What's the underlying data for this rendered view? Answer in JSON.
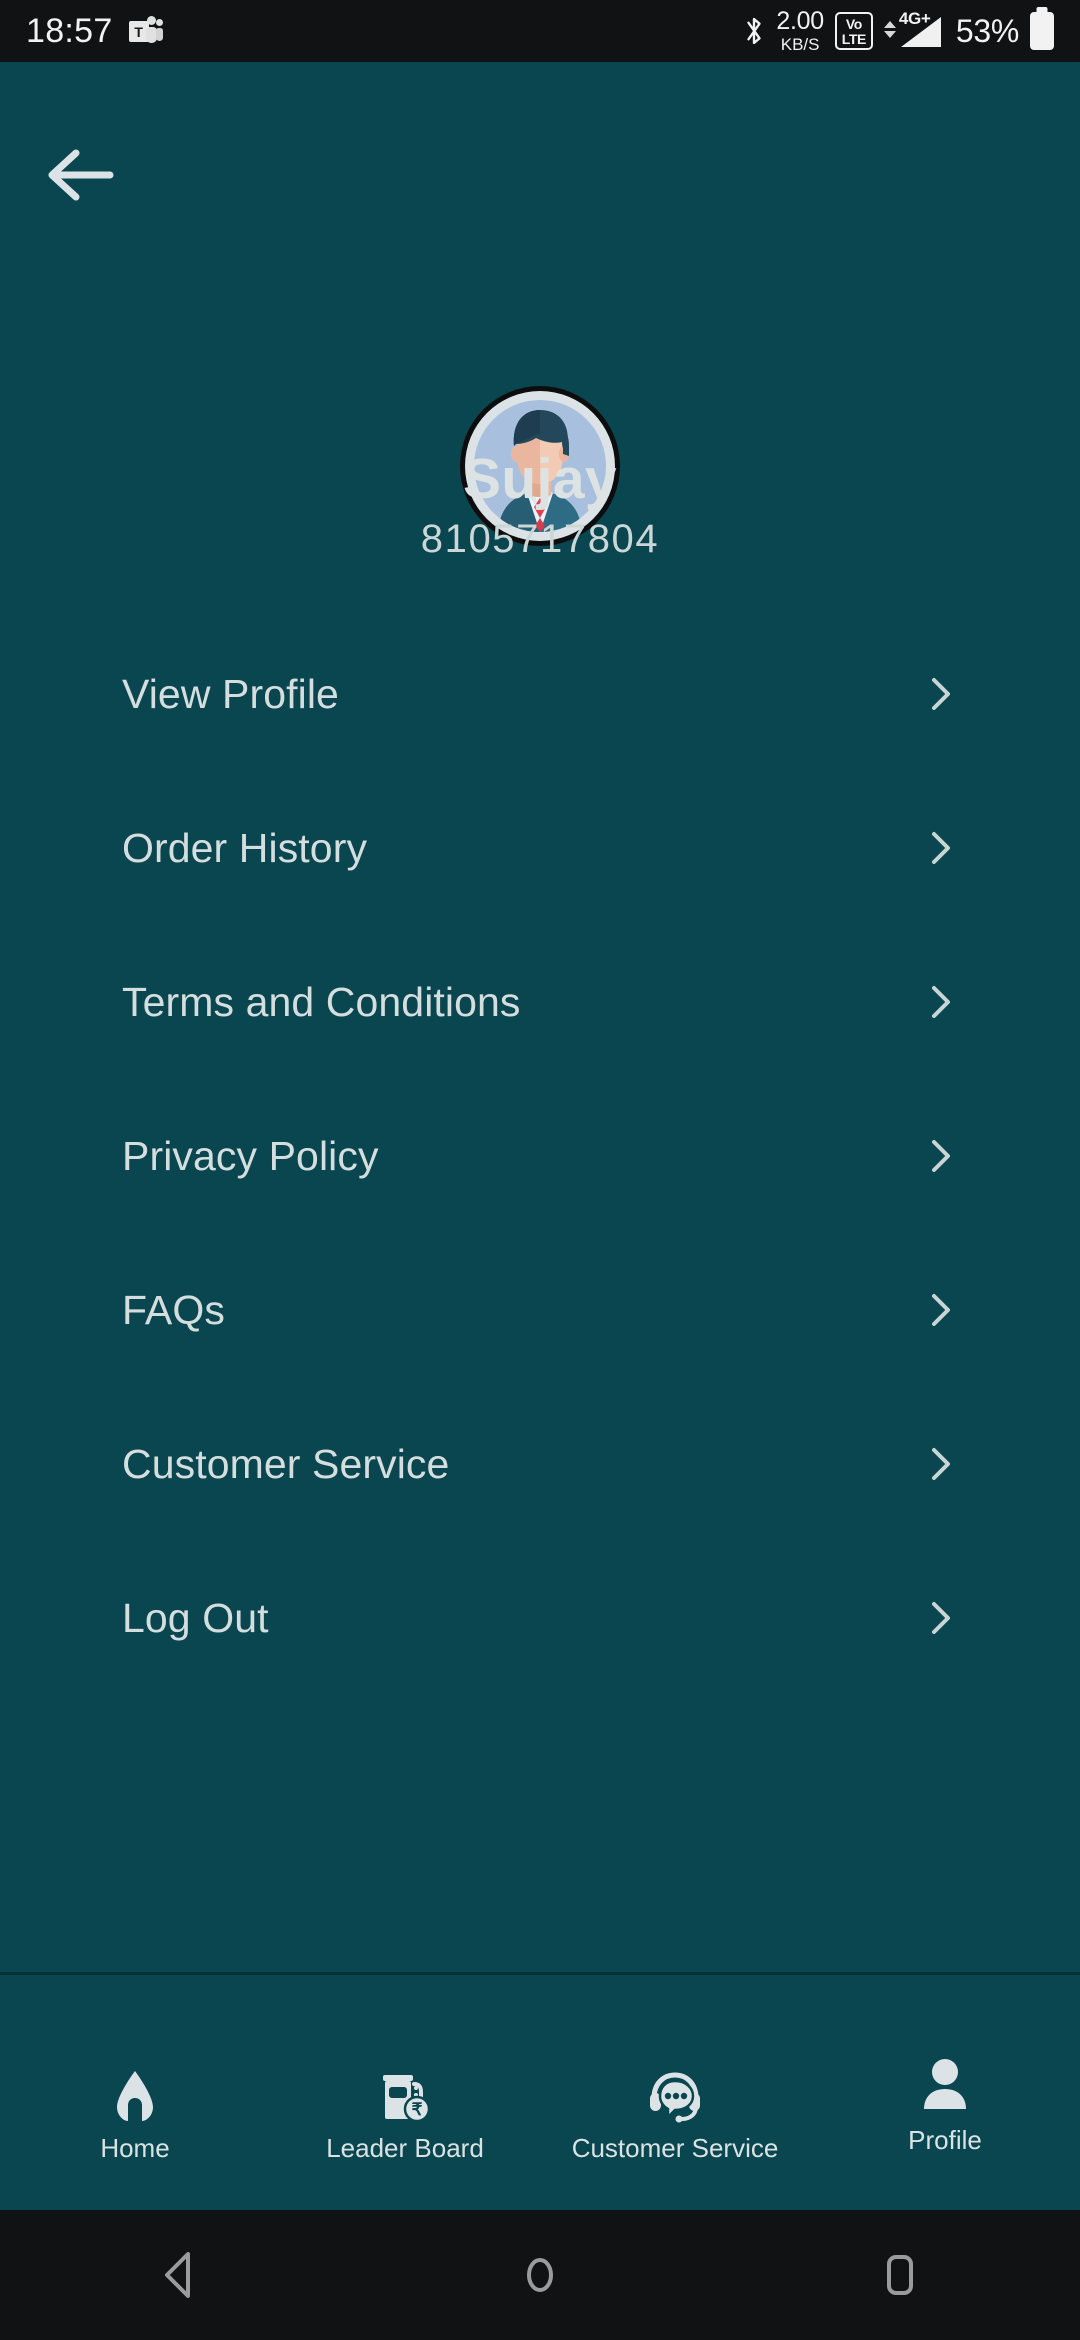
{
  "status_bar": {
    "clock": "18:57",
    "app_icon": "microsoft-teams-icon",
    "bluetooth_icon": "bluetooth-icon",
    "net_speed_value": "2.00",
    "net_speed_unit": "KB/S",
    "volte_top": "Vo",
    "volte_bottom": "LTE",
    "network_generation": "4G+",
    "signal_icon": "signal-bars-icon",
    "battery_percent": "53%",
    "battery_icon": "battery-icon",
    "background_color": "#111213",
    "text_color": "#F2F2F2"
  },
  "header": {
    "back_icon": "back-arrow-icon"
  },
  "profile": {
    "avatar_icon": "user-avatar-illustration",
    "name": "Sujay",
    "phone": "8105717804"
  },
  "menu": {
    "chevron_icon": "chevron-right-icon",
    "items": [
      {
        "label": "View Profile",
        "name": "view-profile"
      },
      {
        "label": "Order History",
        "name": "order-history"
      },
      {
        "label": "Terms and Conditions",
        "name": "terms-and-conditions"
      },
      {
        "label": "Privacy Policy",
        "name": "privacy-policy"
      },
      {
        "label": "FAQs",
        "name": "faqs"
      },
      {
        "label": "Customer Service",
        "name": "customer-service"
      },
      {
        "label": "Log Out",
        "name": "log-out"
      }
    ]
  },
  "bottom_nav": {
    "items": [
      {
        "label": "Home",
        "icon": "home-icon",
        "active": false
      },
      {
        "label": "Leader Board",
        "icon": "fuel-pump-rupee-icon",
        "active": false
      },
      {
        "label": "Customer Service",
        "icon": "headset-chat-icon",
        "active": false
      },
      {
        "label": "Profile",
        "icon": "person-icon",
        "active": true
      }
    ]
  },
  "android_nav": {
    "back_icon": "system-back-icon",
    "home_icon": "system-home-icon",
    "recents_icon": "system-recents-icon"
  },
  "colors": {
    "app_background": "#0A4650",
    "primary_text": "#D5DEDE",
    "avatar_circle": "#A8C0DE",
    "status_bar_bg": "#111213"
  }
}
